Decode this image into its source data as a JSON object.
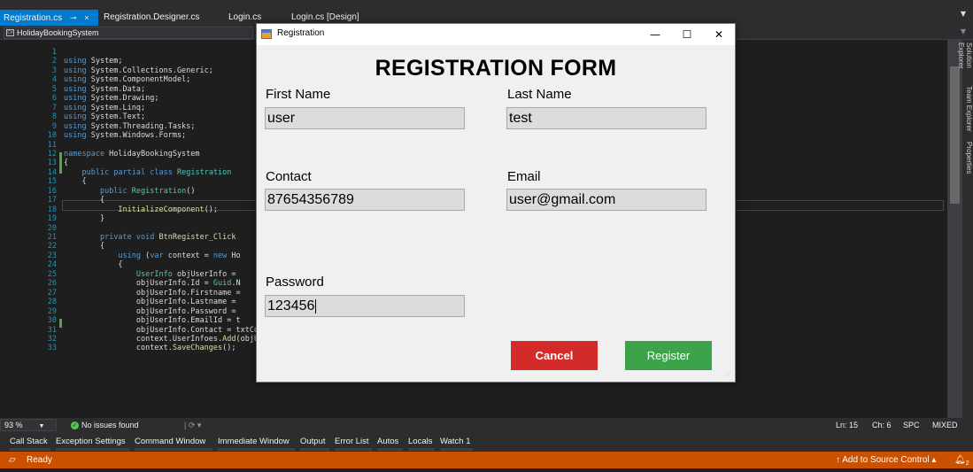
{
  "tabs": [
    {
      "label": "Registration.cs",
      "active": true
    },
    {
      "label": "Registration.Designer.cs",
      "active": false
    },
    {
      "label": "Login.cs",
      "active": false
    },
    {
      "label": "Login.cs [Design]",
      "active": false
    }
  ],
  "tab_pin_icon": "pin-icon",
  "tab_close_glyph": "×",
  "nav": {
    "project": "HolidayBookingSystem"
  },
  "code": {
    "lines": [
      {
        "n": "1",
        "t": ""
      },
      {
        "n": "2",
        "t": "using System;"
      },
      {
        "n": "3",
        "t": "using System.Collections.Generic;"
      },
      {
        "n": "4",
        "t": "using System.ComponentModel;"
      },
      {
        "n": "5",
        "t": "using System.Data;"
      },
      {
        "n": "6",
        "t": "using System.Drawing;"
      },
      {
        "n": "7",
        "t": "using System.Linq;"
      },
      {
        "n": "8",
        "t": "using System.Text;"
      },
      {
        "n": "9",
        "t": "using System.Threading.Tasks;"
      },
      {
        "n": "10",
        "t": "using System.Windows.Forms;"
      },
      {
        "n": "11",
        "t": ""
      },
      {
        "n": "12",
        "t": "namespace HolidayBookingSystem"
      },
      {
        "n": "13",
        "t": "{"
      },
      {
        "n": "14",
        "t": "    public partial class Registration"
      },
      {
        "n": "15",
        "t": "    {"
      },
      {
        "n": "16",
        "t": "        public Registration()"
      },
      {
        "n": "17",
        "t": "        {"
      },
      {
        "n": "18",
        "t": "            InitializeComponent();"
      },
      {
        "n": "19",
        "t": "        }"
      },
      {
        "n": "20",
        "t": ""
      },
      {
        "n": "21",
        "t": "        private void BtnRegister_Click"
      },
      {
        "n": "22",
        "t": "        {"
      },
      {
        "n": "23",
        "t": "            using (var context = new Ho"
      },
      {
        "n": "24",
        "t": "            {"
      },
      {
        "n": "25",
        "t": "                UserInfo objUserInfo = "
      },
      {
        "n": "26",
        "t": "                objUserInfo.Id = Guid.N"
      },
      {
        "n": "27",
        "t": "                objUserInfo.Firstname ="
      },
      {
        "n": "28",
        "t": "                objUserInfo.Lastname ="
      },
      {
        "n": "29",
        "t": "                objUserInfo.Password ="
      },
      {
        "n": "30",
        "t": "                objUserInfo.EmailId = t"
      },
      {
        "n": "31",
        "t": "                objUserInfo.Contact = txtContact.Text;"
      },
      {
        "n": "32",
        "t": "                context.UserInfoes.Add(objUserInfo);"
      },
      {
        "n": "33",
        "t": "                context.SaveChanges();"
      }
    ]
  },
  "side_tabs": [
    "Solution Explorer",
    "Team Explorer",
    "Properties"
  ],
  "editor_status": {
    "zoom": "93 %",
    "issues": "No issues found",
    "ln": "Ln: 15",
    "ch": "Ch: 6",
    "spc": "SPC",
    "eol": "MIXED"
  },
  "tool_windows": [
    "Call Stack",
    "Exception Settings",
    "Command Window",
    "Immediate Window",
    "Output",
    "Error List",
    "Autos",
    "Locals",
    "Watch 1"
  ],
  "status_bar": {
    "ready": "Ready",
    "source_control": "Add to Source Control",
    "notifications": "2",
    "color": "#ca5100"
  },
  "dialog": {
    "title": "Registration",
    "heading": "REGISTRATION FORM",
    "minimize_glyph": "—",
    "maximize_glyph": "☐",
    "close_glyph": "✕",
    "fields": {
      "first_name": {
        "label": "First Name",
        "value": "user"
      },
      "last_name": {
        "label": "Last Name",
        "value": "test"
      },
      "contact": {
        "label": "Contact",
        "value": "87654356789"
      },
      "email": {
        "label": "Email",
        "value": "user@gmail.com"
      },
      "password": {
        "label": "Password",
        "value": "123456"
      }
    },
    "buttons": {
      "cancel": {
        "label": "Cancel",
        "color": "#d32a2a"
      },
      "register": {
        "label": "Register",
        "color": "#3ca34a"
      }
    }
  }
}
